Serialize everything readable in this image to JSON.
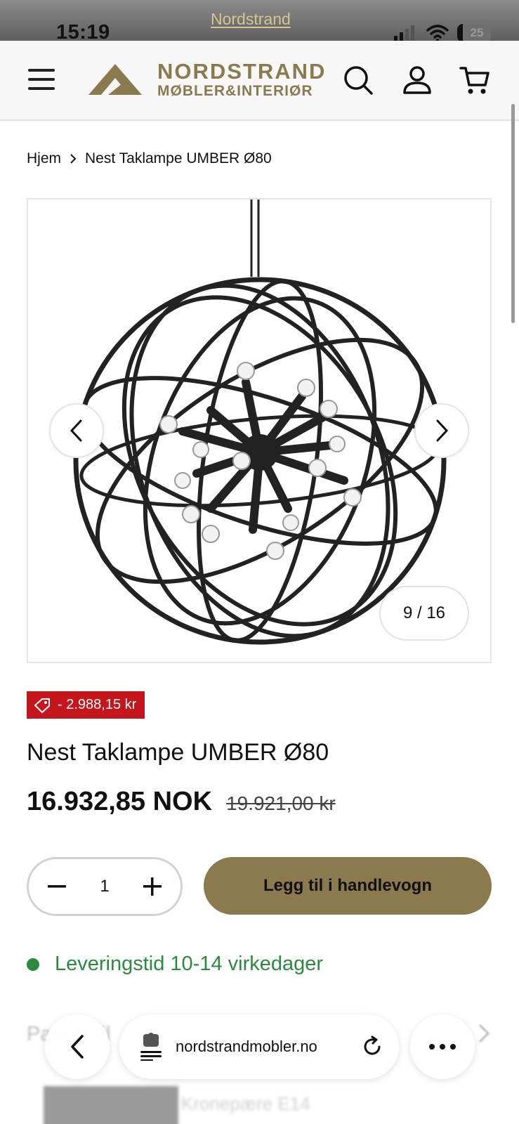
{
  "status_bar": {
    "time": "15:19",
    "promo_link": "Nordstrand",
    "battery": "25"
  },
  "header": {
    "logo_line1": "NORDSTRAND",
    "logo_line2": "MØBLER&INTERIØR",
    "brand_color": "#8b7a4e"
  },
  "breadcrumb": {
    "home": "Hjem",
    "current": "Nest Taklampe UMBER Ø80"
  },
  "gallery": {
    "counter": "9 / 16"
  },
  "product": {
    "discount": "- 2.988,15 kr",
    "title": "Nest Taklampe UMBER Ø80",
    "price": "16.932,85 NOK",
    "old_price": "19.921,00 kr",
    "quantity": "1",
    "add_to_cart": "Legg til i handlevogn",
    "delivery": "Leveringstid 10-14 virkedager",
    "delivery_color": "#2b8a3e",
    "discount_color": "#c4161c"
  },
  "background_content": {
    "section_heading": "Passer til",
    "item_name": "Kronepære E14"
  },
  "browser": {
    "url": "nordstrandmobler.no"
  }
}
